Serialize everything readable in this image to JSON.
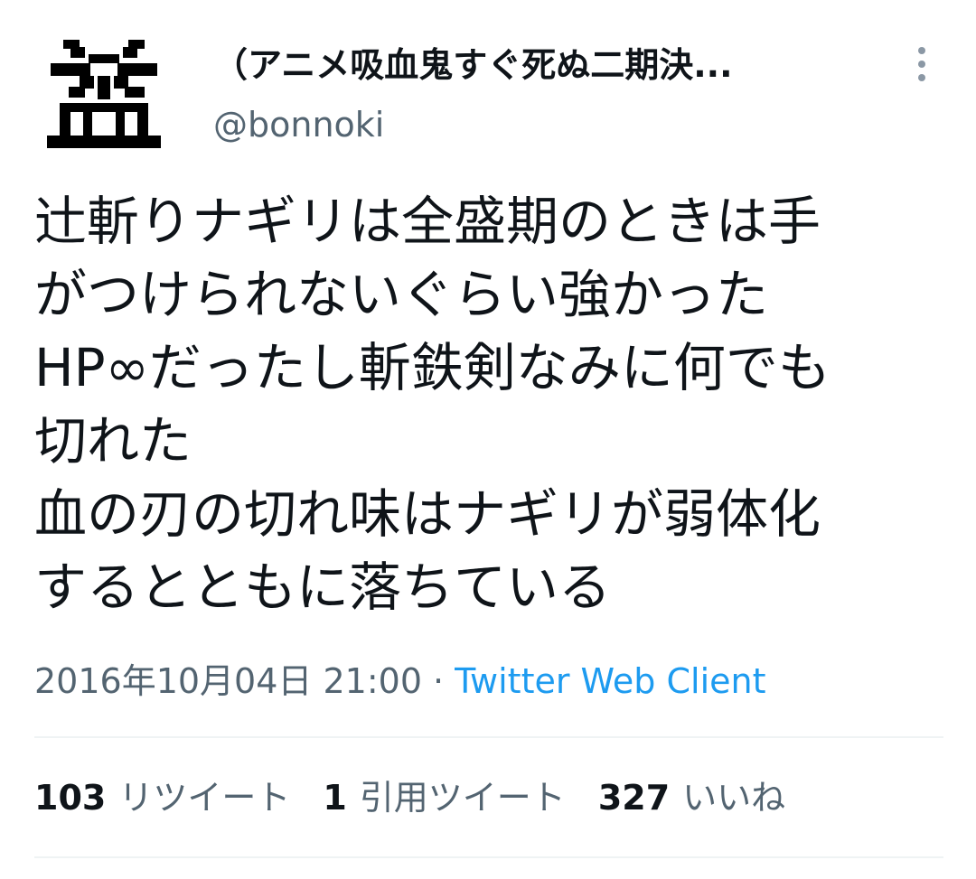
{
  "tweet": {
    "avatar": {
      "glyph": "盆",
      "icon": "avatar-kanji-glyph"
    },
    "author": {
      "display_name": "（アニメ吸血鬼すぐ死ぬ二期決...",
      "handle": "@bonnoki"
    },
    "more_icon": "more-vertical-icon",
    "text": "辻斬りナギリは全盛期のときは手\nがつけられないぐらい強かった\nHP∞だったし斬鉄剣なみに何でも\n切れた\n血の刃の切れ味はナギリが弱体化\nするとともに落ちている",
    "meta": {
      "timestamp": "2016年10月04日 21:00",
      "separator": "·",
      "source": "Twitter Web Client"
    },
    "stats": {
      "retweets": {
        "count": "103",
        "label": "リツイート"
      },
      "quotes": {
        "count": "1",
        "label": "引用ツイート"
      },
      "likes": {
        "count": "327",
        "label": "いいね"
      }
    },
    "colors": {
      "text_primary": "#0f1419",
      "text_secondary": "#536471",
      "link": "#1d9bf0",
      "divider": "#eff3f4"
    }
  }
}
